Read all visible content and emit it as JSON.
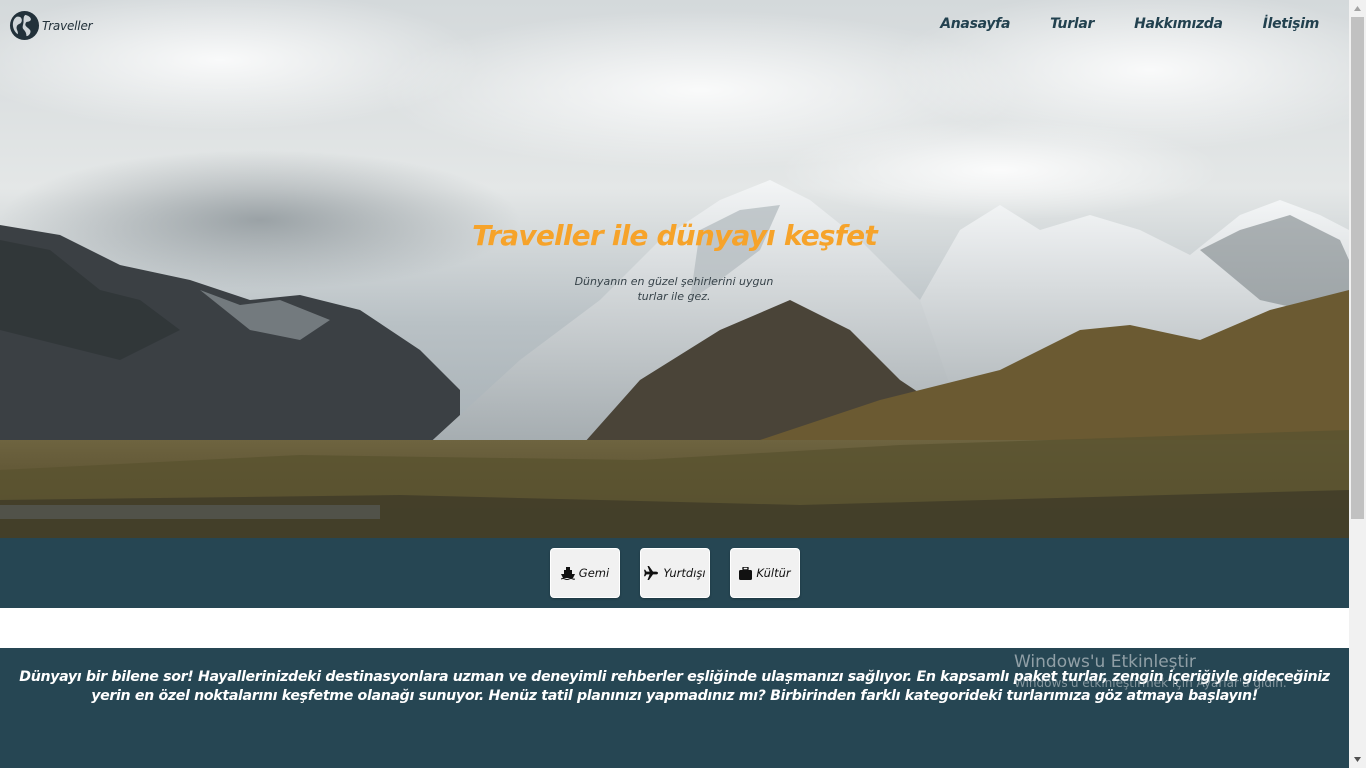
{
  "header": {
    "brand": "Traveller",
    "nav": [
      "Anasayfa",
      "Turlar",
      "Hakkımızda",
      "İletişim"
    ]
  },
  "hero": {
    "title": "Traveller ile dünyayı keşfet",
    "subtitle_line1": "Dünyanın en güzel şehirlerini uygun",
    "subtitle_line2": "turlar ile gez."
  },
  "categories": [
    {
      "label": "Gemi",
      "icon": "ship-icon"
    },
    {
      "label": "Yurtdışı",
      "icon": "plane-icon"
    },
    {
      "label": "Kültür",
      "icon": "suitcase-icon"
    }
  ],
  "about": {
    "text": "Dünyayı bir bilene sor! Hayallerinizdeki destinasyonlara uzman ve deneyimli rehberler eşliğinde ulaşmanızı sağlıyor. En kapsamlı paket turlar, zengin içeriğiyle gideceğiniz yerin en özel noktalarını keşfetme olanağı sunuyor. Henüz tatil planınızı yapmadınız mı? Birbirinden farklı kategorideki turlarımıza göz atmaya başlayın!"
  },
  "watermark": {
    "title": "Windows'u Etkinleştir",
    "subtitle": "Windows'u etkinleştirmek için Ayarlar'a gidin."
  },
  "colors": {
    "accent": "#f6a32a",
    "band": "#264653",
    "nav_text": "#22414f"
  }
}
